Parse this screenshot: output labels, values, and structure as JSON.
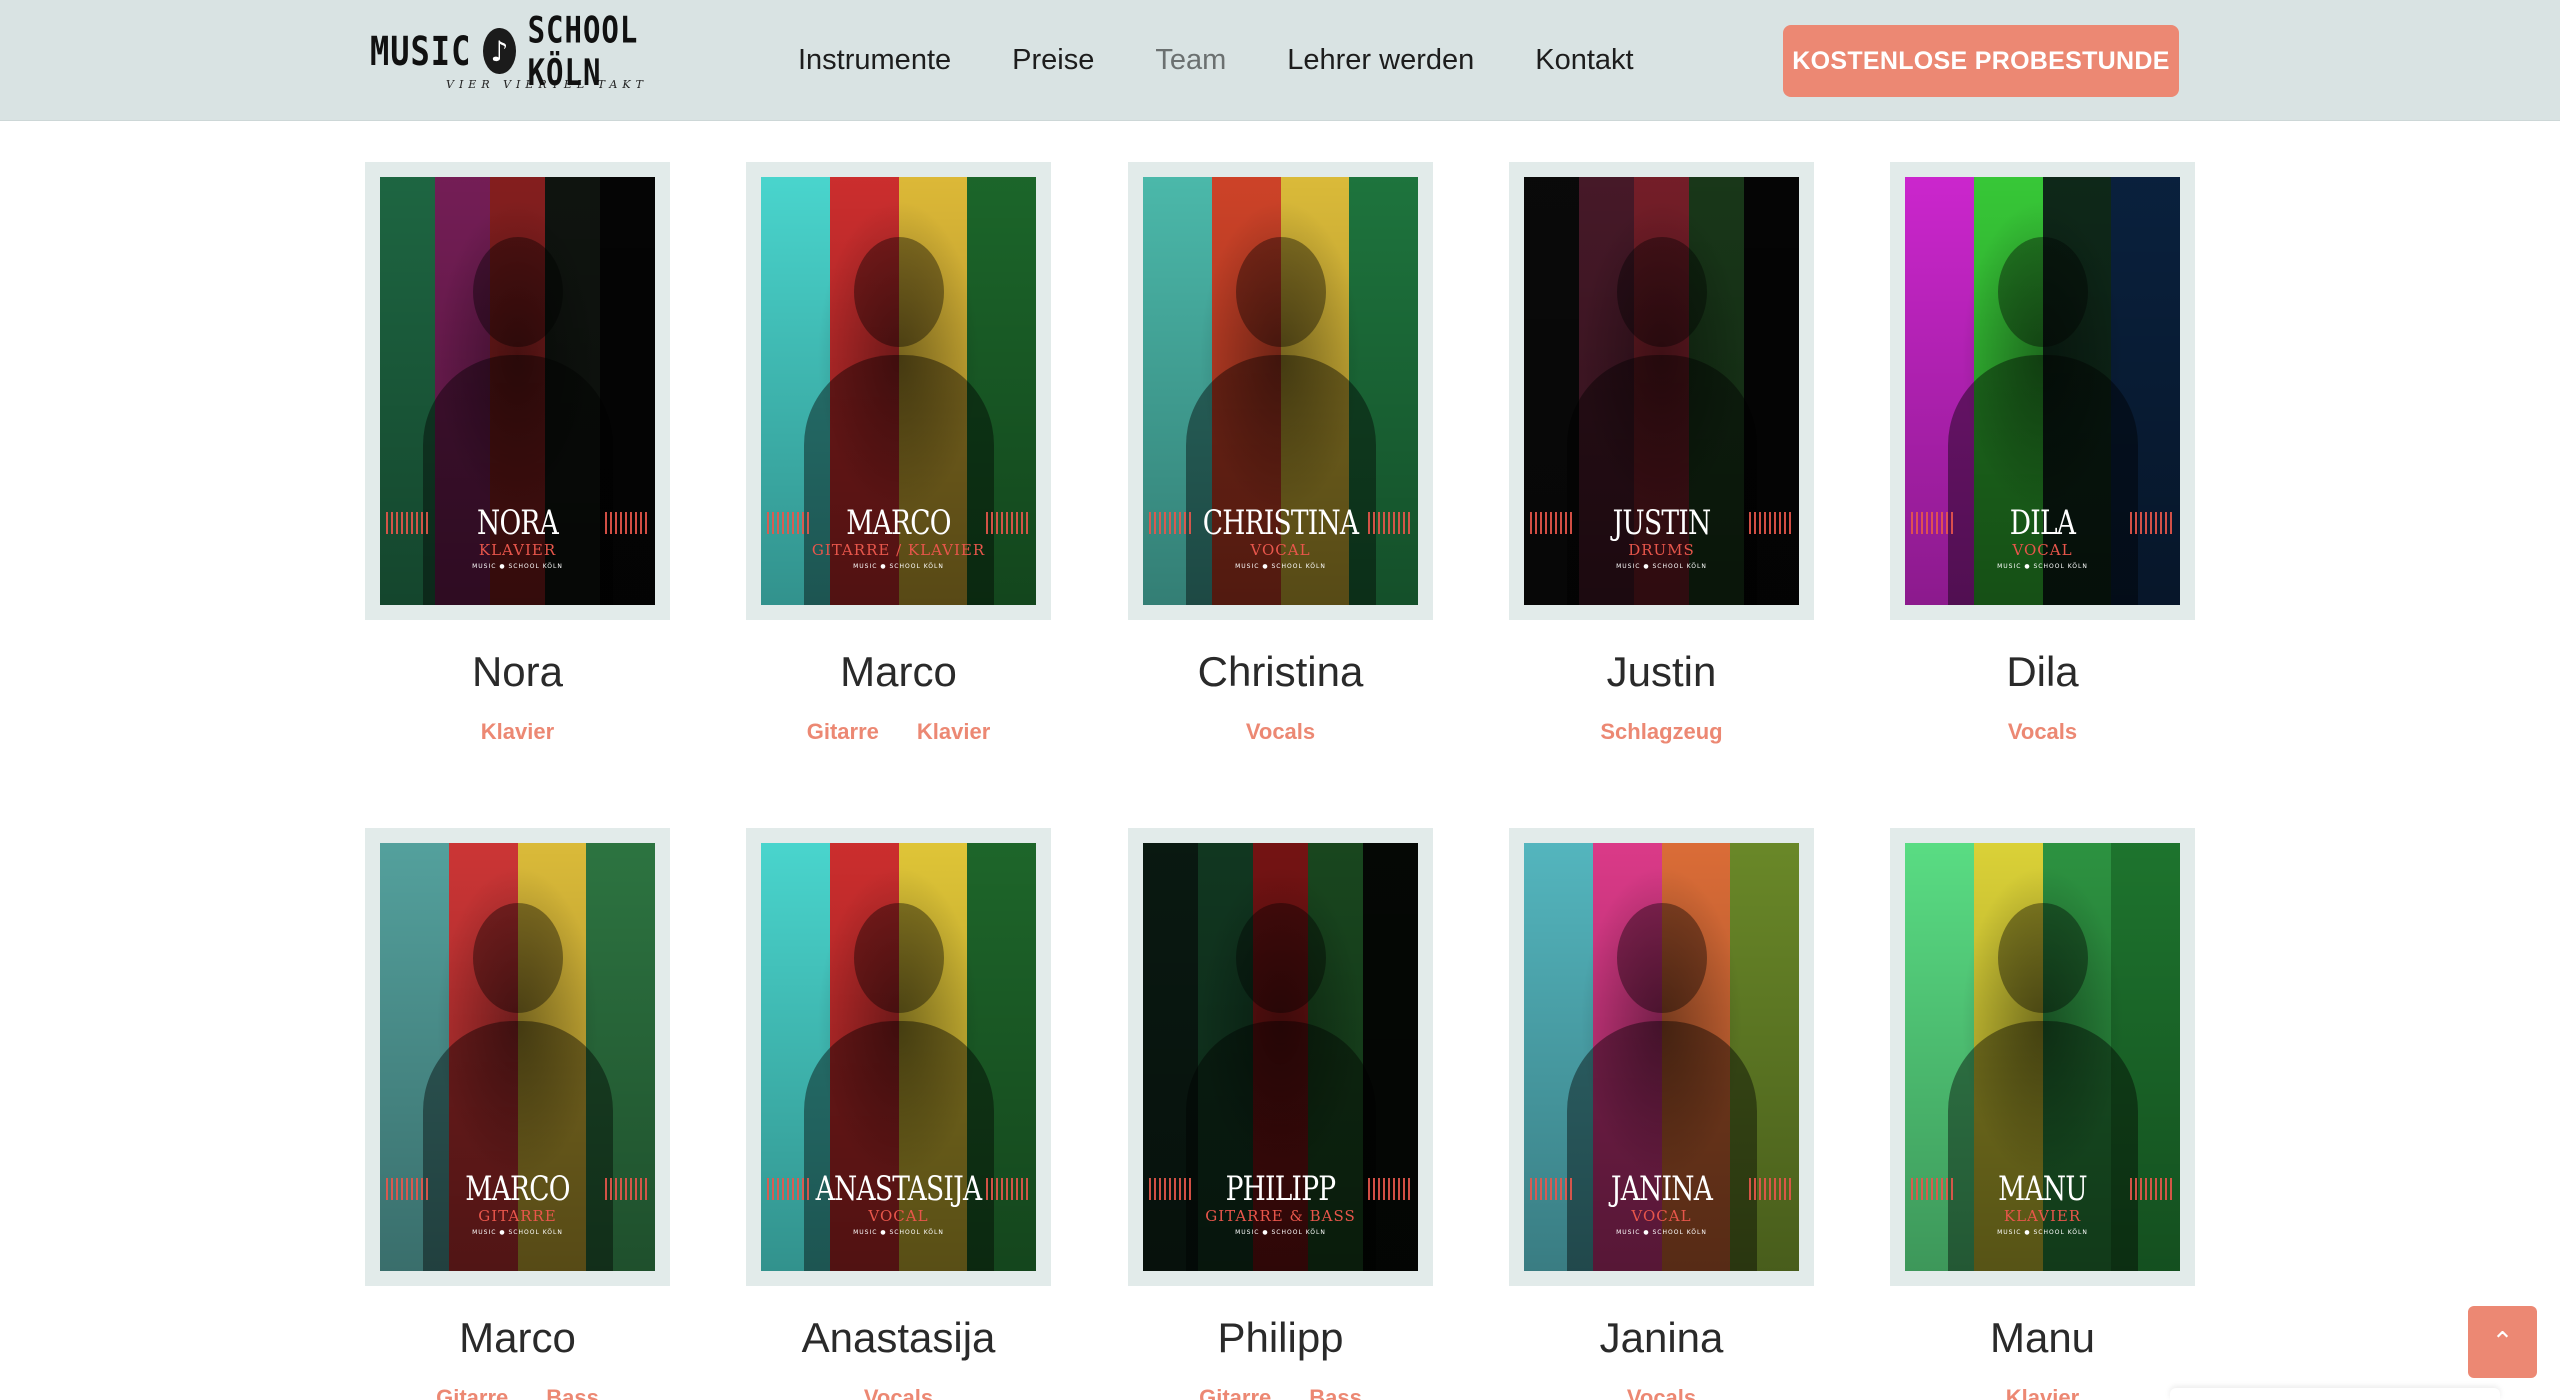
{
  "header": {
    "logo": {
      "word1": "MUSIC",
      "word2": "SCHOOL KÖLN",
      "tagline": "VIER VIERTEL TAKT"
    },
    "nav": [
      {
        "label": "Instrumente"
      },
      {
        "label": "Preise"
      },
      {
        "label": "Team"
      },
      {
        "label": "Lehrer werden"
      },
      {
        "label": "Kontakt"
      }
    ],
    "active_nav": "Team",
    "cta_label": "KOSTENLOSE PROBESTUNDE"
  },
  "poster_brand": "MUSIC ● SCHOOL KÖLN",
  "team": [
    {
      "name": "Nora",
      "poster_name": "NORA",
      "poster_instrument": "KLAVIER",
      "tags": [
        "Klavier"
      ],
      "stripes": [
        "#1f6b45",
        "#7a1f5a",
        "#8b2020",
        "#101510",
        "#050505"
      ]
    },
    {
      "name": "Marco",
      "poster_name": "MARCO",
      "poster_instrument": "GITARRE / KLAVIER",
      "tags": [
        "Gitarre",
        "Klavier"
      ],
      "stripes": [
        "#4de0d8",
        "#d63030",
        "#e8c23a",
        "#1d6b2c"
      ]
    },
    {
      "name": "Christina",
      "poster_name": "CHRISTINA",
      "poster_instrument": "VOCAL",
      "tags": [
        "Vocals"
      ],
      "stripes": [
        "#4fc2b3",
        "#d8462a",
        "#e6c43c",
        "#1f7a40"
      ]
    },
    {
      "name": "Justin",
      "poster_name": "JUSTIN",
      "poster_instrument": "DRUMS",
      "tags": [
        "Schlagzeug"
      ],
      "stripes": [
        "#0a0a0a",
        "#4a1a2a",
        "#7a1f2a",
        "#1a3a1a",
        "#050505"
      ]
    },
    {
      "name": "Dila",
      "poster_name": "DILA",
      "poster_instrument": "VOCAL",
      "tags": [
        "Vocals"
      ],
      "stripes": [
        "#d628d8",
        "#3ad23a",
        "#0f2a1a",
        "#0a2240"
      ]
    },
    {
      "name": "Marco",
      "poster_name": "MARCO",
      "poster_instrument": "GITARRE",
      "tags": [
        "Gitarre",
        "Bass"
      ],
      "stripes": [
        "#58a9a5",
        "#d63838",
        "#e6c43c",
        "#2f7a44"
      ]
    },
    {
      "name": "Anastasija",
      "poster_name": "ANASTASIJA",
      "poster_instrument": "VOCAL",
      "tags": [
        "Vocals"
      ],
      "stripes": [
        "#4de0d8",
        "#d63030",
        "#ebcf3a",
        "#1f6b2c"
      ]
    },
    {
      "name": "Philipp",
      "poster_name": "PHILIPP",
      "poster_instrument": "GITARRE & BASS",
      "tags": [
        "Gitarre",
        "Bass"
      ],
      "stripes": [
        "#0a1a12",
        "#123a22",
        "#7a1414",
        "#1a4a20",
        "#050805"
      ]
    },
    {
      "name": "Janina",
      "poster_name": "JANINA",
      "poster_instrument": "VOCAL",
      "tags": [
        "Vocals"
      ],
      "stripes": [
        "#58bfc8",
        "#e63d8f",
        "#e6723a",
        "#6f8f2a"
      ]
    },
    {
      "name": "Manu",
      "poster_name": "MANU",
      "poster_instrument": "KLAVIER",
      "tags": [
        "Klavier"
      ],
      "stripes": [
        "#5ee88a",
        "#e6dc3a",
        "#2f9a44",
        "#1f7a30"
      ]
    }
  ],
  "scroll_top_icon": "chevron-up-icon"
}
